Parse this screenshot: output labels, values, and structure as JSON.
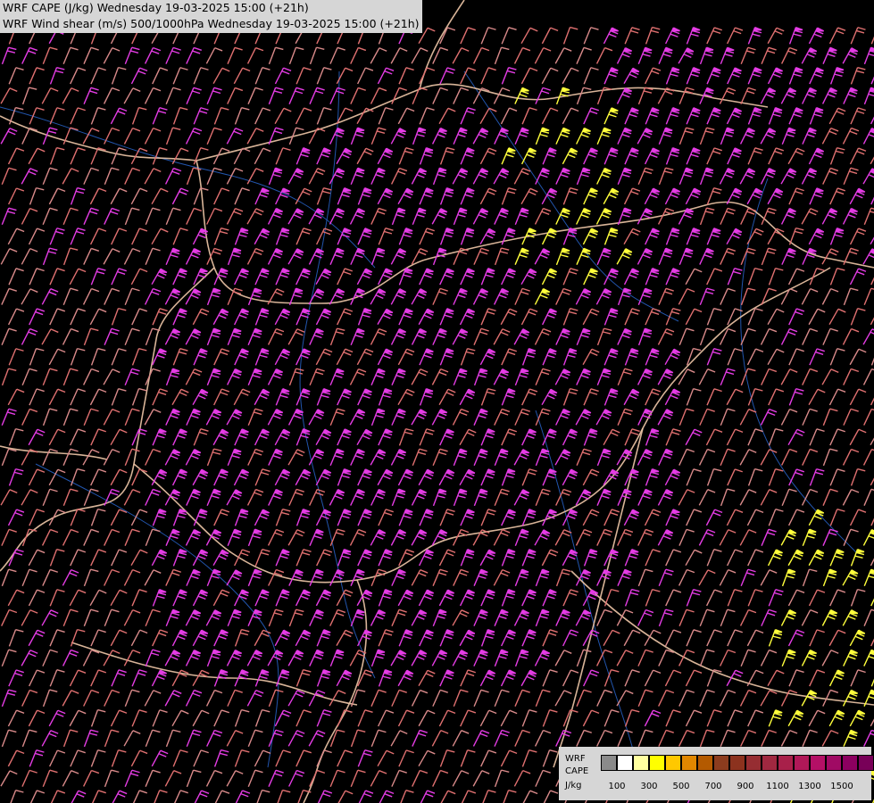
{
  "titles": {
    "line1": "WRF CAPE (J/kg) Wednesday 19-03-2025 15:00 (+21h)",
    "line2": "WRF Wind shear (m/s) 500/1000hPa Wednesday 19-03-2025 15:00 (+21h)"
  },
  "legend": {
    "label_model": "WRF",
    "label_field": "CAPE",
    "label_unit": "J/kg",
    "colors": [
      "#8a8a8a",
      "#ffffff",
      "#ffffa0",
      "#ffff00",
      "#ffc800",
      "#e18700",
      "#b45a00",
      "#8c3c1e",
      "#8c321e",
      "#962d32",
      "#a02840",
      "#a8204a",
      "#b01858",
      "#b41066",
      "#a00a64",
      "#8c0060",
      "#780058"
    ],
    "ticks": [
      "100",
      "300",
      "500",
      "700",
      "900",
      "1100",
      "1300",
      "1500"
    ]
  },
  "map_colors": {
    "barb_weak": "#d98a8a",
    "barb_mid": "#e07070",
    "barb_strong": "#e43ce4",
    "barb_max": "#ffff3c",
    "border": "#f0c8a8",
    "river": "#2a6ad8"
  }
}
